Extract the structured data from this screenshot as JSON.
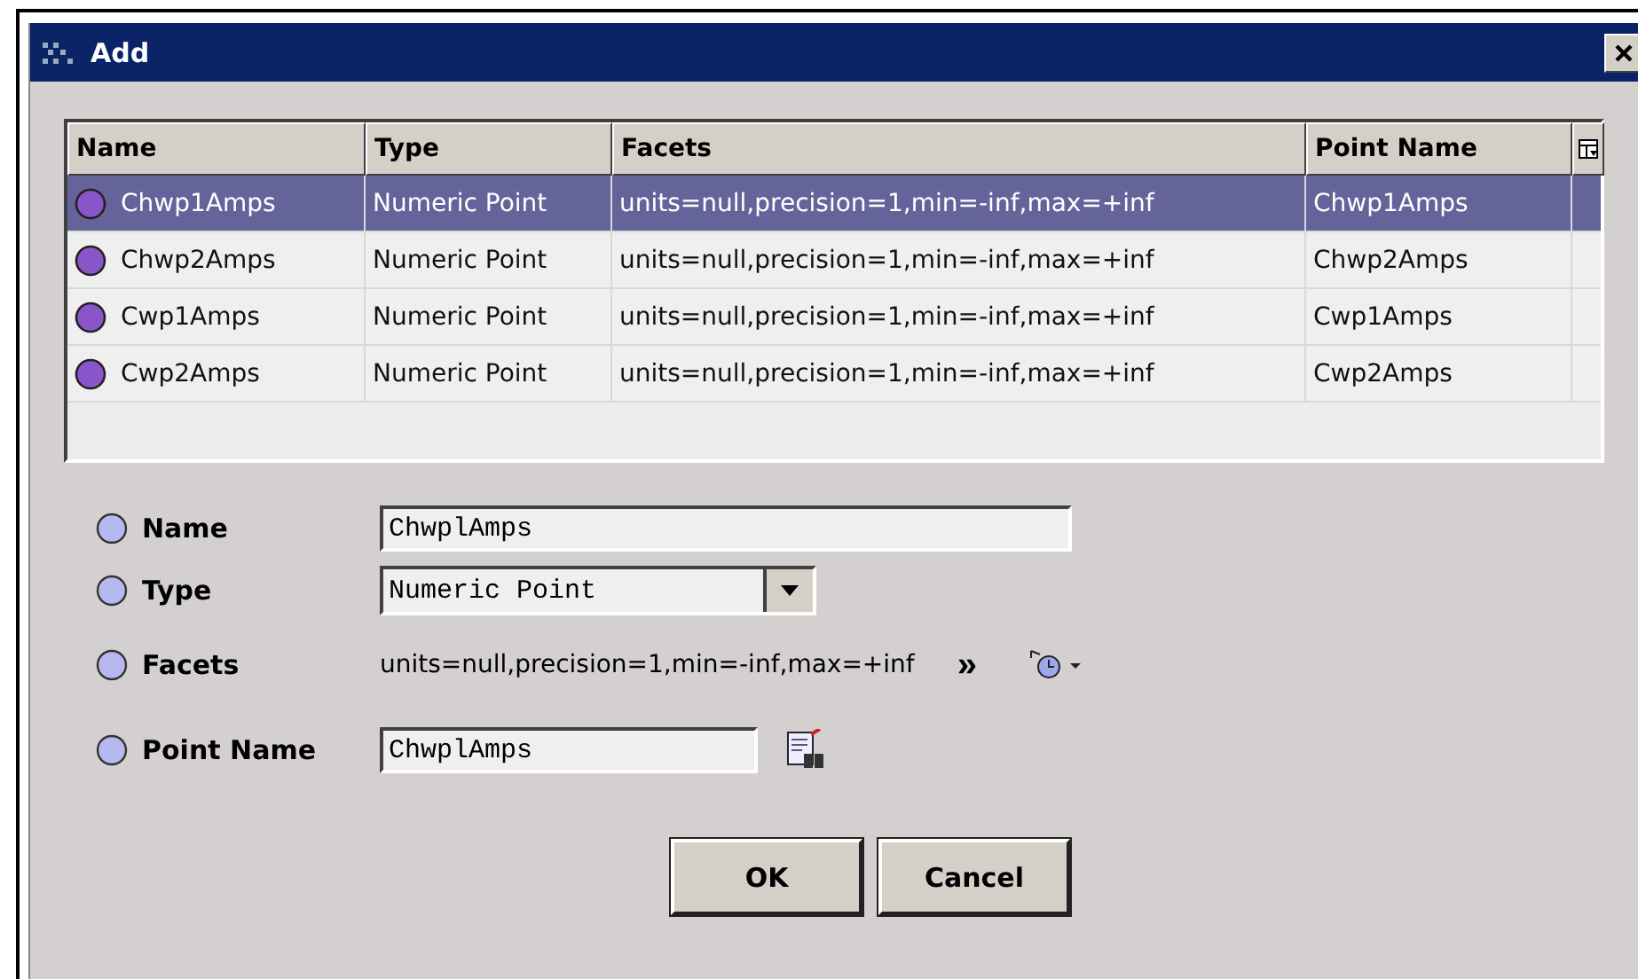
{
  "window": {
    "title": "Add"
  },
  "table": {
    "columns": [
      "Name",
      "Type",
      "Facets",
      "Point Name"
    ],
    "rows": [
      {
        "selected": true,
        "cells": [
          "Chwp1Amps",
          "Numeric Point",
          "units=null,precision=1,min=-inf,max=+inf",
          "Chwp1Amps"
        ]
      },
      {
        "selected": false,
        "cells": [
          "Chwp2Amps",
          "Numeric Point",
          "units=null,precision=1,min=-inf,max=+inf",
          "Chwp2Amps"
        ]
      },
      {
        "selected": false,
        "cells": [
          "Cwp1Amps",
          "Numeric Point",
          "units=null,precision=1,min=-inf,max=+inf",
          "Cwp1Amps"
        ]
      },
      {
        "selected": false,
        "cells": [
          "Cwp2Amps",
          "Numeric Point",
          "units=null,precision=1,min=-inf,max=+inf",
          "Cwp2Amps"
        ]
      }
    ]
  },
  "form": [
    {
      "kind": "text",
      "label": "Name",
      "checked": false,
      "value": "ChwplAmps"
    },
    {
      "kind": "select",
      "label": "Type",
      "checked": false,
      "value": "Numeric Point"
    },
    {
      "kind": "facets",
      "label": "Facets",
      "checked": false,
      "value": "units=null,precision=1,min=-inf,max=+inf",
      "more": "»"
    },
    {
      "kind": "point",
      "label": "Point Name",
      "checked": false,
      "value": "ChwplAmps"
    }
  ],
  "buttons": [
    "OK",
    "Cancel"
  ]
}
